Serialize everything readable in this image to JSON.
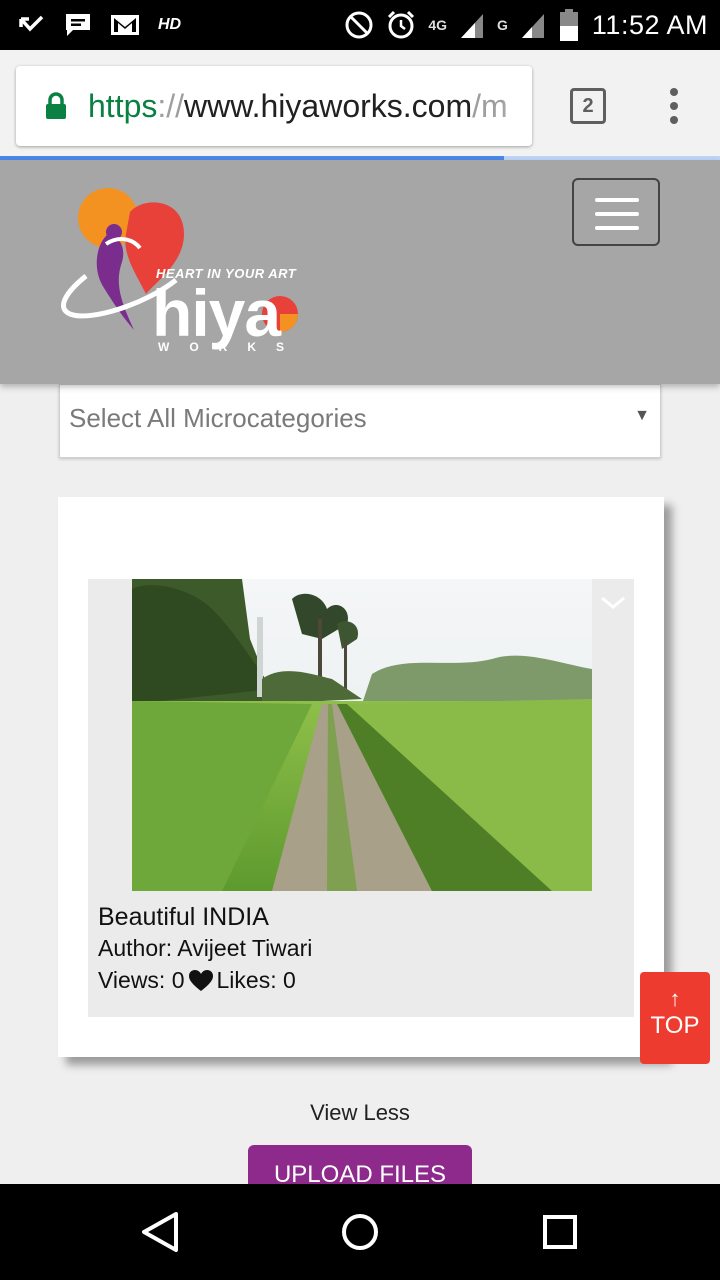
{
  "status_bar": {
    "hd": "HD",
    "net_1": "4G",
    "net_2": "G",
    "time": "11:52 AM"
  },
  "browser": {
    "url_scheme": "https",
    "url_sep": "://",
    "url_host": "www.hiyaworks.com",
    "url_path": "/m",
    "tab_count": "2",
    "load_progress_percent": 70
  },
  "header": {
    "logo_tagline": "HEART IN YOUR ART",
    "logo_word": "hiya",
    "logo_sub": "WORKS"
  },
  "filter": {
    "microcategory_selected": "Select All Microcategories"
  },
  "gallery": {
    "items": [
      {
        "title": "Beautiful INDIA",
        "author": "Author: Avijeet Tiwari",
        "views": "Views: 0",
        "likes": "Likes: 0"
      }
    ]
  },
  "actions": {
    "top_arrow": "↑",
    "top_label": "TOP",
    "view_less": "View Less",
    "upload": "UPLOAD FILES"
  },
  "colors": {
    "header_bg": "#a6a6a6",
    "top_button": "#ee3b2f",
    "upload_button": "#8e2a8c",
    "url_green": "#0b8043"
  }
}
